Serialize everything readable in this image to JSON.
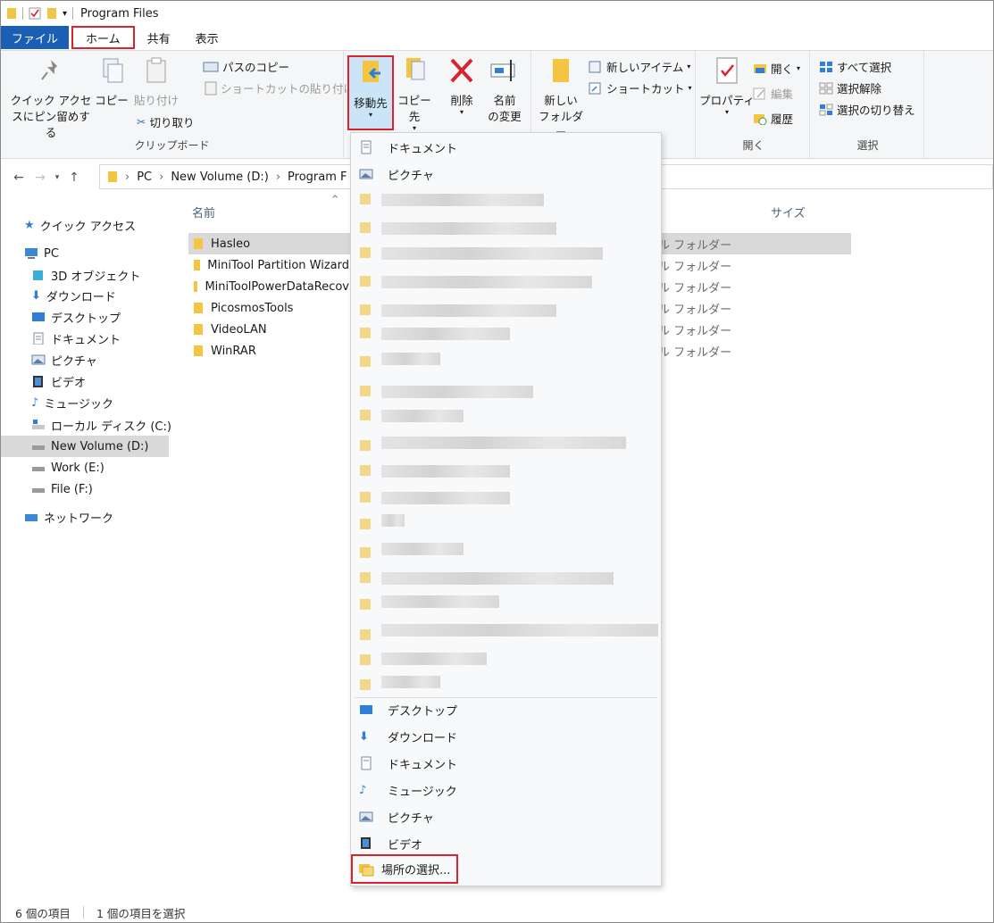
{
  "window": {
    "title": "Program Files"
  },
  "tabs": [
    "ファイル",
    "ホーム",
    "共有",
    "表示"
  ],
  "ribbon": {
    "clipboard": {
      "pin_label_1": "クイック アクセ",
      "pin_label_2": "スにピン留めする",
      "copy": "コピー",
      "paste": "貼り付け",
      "copy_path": "パスのコピー",
      "paste_shortcut": "ショートカットの貼り付け",
      "cut": "切り取り",
      "group": "クリップボード"
    },
    "organize": {
      "move_to": "移動先",
      "copy_to": "コピー先",
      "delete": "削除",
      "rename_1": "名前",
      "rename_2": "の変更"
    },
    "new": {
      "new_folder_1": "新しい",
      "new_folder_2": "フォルダー",
      "new_item": "新しいアイテム",
      "easy_access": "ショートカット"
    },
    "open": {
      "properties": "プロパティ",
      "open": "開く",
      "edit": "編集",
      "history": "履歴",
      "group": "開く"
    },
    "select": {
      "select_all": "すべて選択",
      "select_none": "選択解除",
      "invert": "選択の切り替え",
      "group": "選択"
    }
  },
  "address": {
    "crumbs": [
      "PC",
      "New Volume (D:)",
      "Program F"
    ]
  },
  "nav": {
    "quick_access": "クイック アクセス",
    "pc": "PC",
    "objects3d": "3D オブジェクト",
    "downloads": "ダウンロード",
    "desktop": "デスクトップ",
    "documents": "ドキュメント",
    "pictures": "ピクチャ",
    "videos": "ビデオ",
    "music": "ミュージック",
    "local_c": "ローカル ディスク (C:)",
    "new_volume_d": "New Volume (D:)",
    "work_e": "Work (E:)",
    "file_f": "File (F:)",
    "network": "ネットワーク"
  },
  "list": {
    "col_name": "名前",
    "col_size": "サイズ",
    "rows": [
      {
        "name": "Hasleo",
        "type": "ル フォルダー"
      },
      {
        "name": "MiniTool Partition Wizard",
        "type": "ル フォルダー"
      },
      {
        "name": "MiniToolPowerDataRecov",
        "type": "ル フォルダー"
      },
      {
        "name": "PicosmosTools",
        "type": "ル フォルダー"
      },
      {
        "name": "VideoLAN",
        "type": "ル フォルダー"
      },
      {
        "name": "WinRAR",
        "type": "ル フォルダー"
      }
    ]
  },
  "dropdown": {
    "top": [
      "ドキュメント",
      "ピクチャ"
    ],
    "bottom": [
      "デスクトップ",
      "ダウンロード",
      "ドキュメント",
      "ミュージック",
      "ピクチャ",
      "ビデオ"
    ],
    "choose_location": "場所の選択..."
  },
  "status": {
    "count": "6 個の項目",
    "selected": "1 個の項目を選択"
  },
  "colors": {
    "file_tab": "#1a5fb4",
    "highlight": "#d9232e",
    "folder": "#f4c542"
  }
}
